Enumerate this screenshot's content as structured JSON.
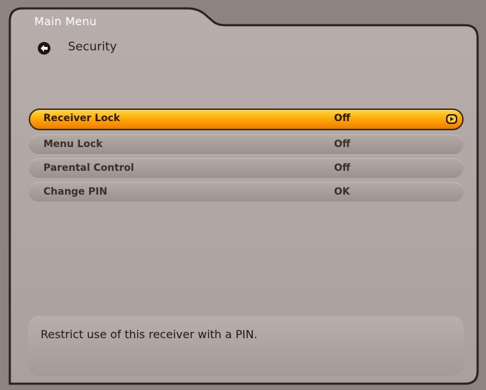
{
  "header": {
    "title": "Main Menu",
    "subtitle": "Security",
    "back_icon": "back-arrow-icon"
  },
  "menu": {
    "items": [
      {
        "label": "Receiver Lock",
        "value": "Off",
        "selected": true
      },
      {
        "label": "Menu Lock",
        "value": "Off",
        "selected": false
      },
      {
        "label": "Parental Control",
        "value": "Off",
        "selected": false
      },
      {
        "label": "Change PIN",
        "value": "OK",
        "selected": false
      }
    ],
    "selected_arrow_icon": "right-arrow-icon"
  },
  "help": {
    "text": "Restrict use of this receiver with a PIN."
  },
  "colors": {
    "highlight": "#ffb10a",
    "panel": "#b1a7a4",
    "background": "#8d8380"
  }
}
